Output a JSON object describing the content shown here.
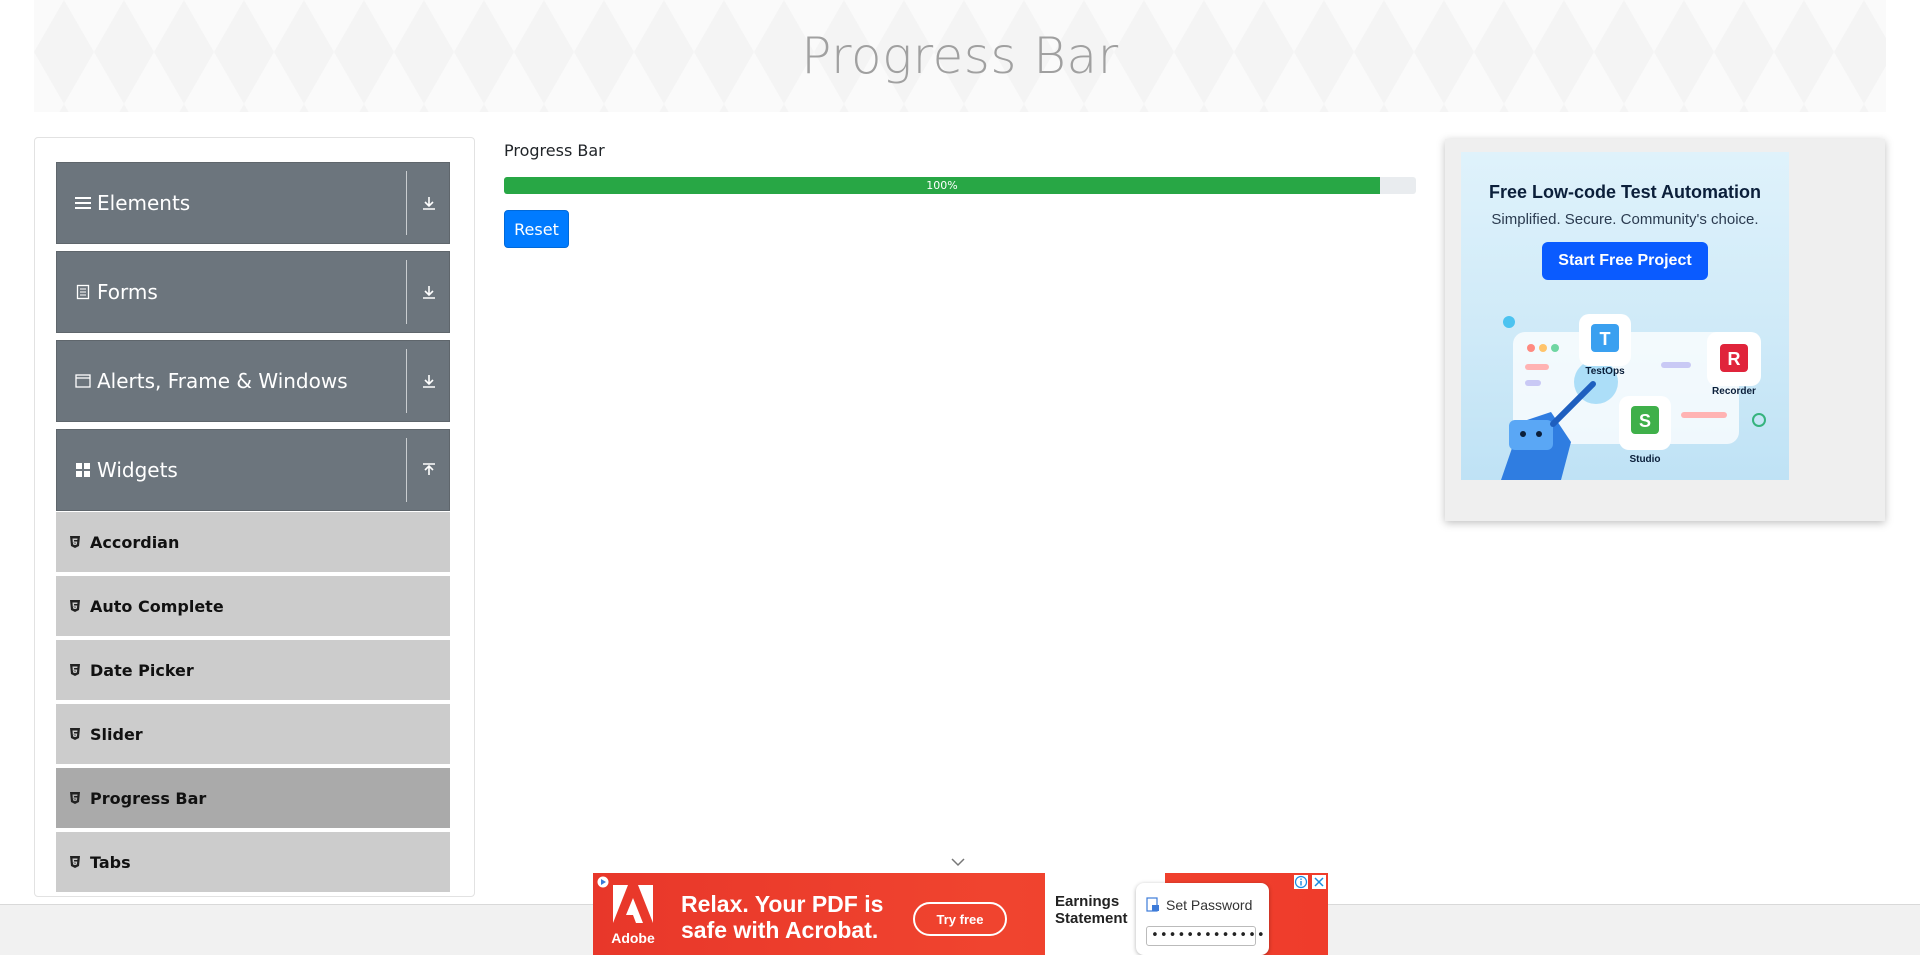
{
  "header": {
    "title": "Progress Bar"
  },
  "sidebar": {
    "groups": [
      {
        "label": "Elements",
        "icon": "hamburger-icon",
        "expanded": false
      },
      {
        "label": "Forms",
        "icon": "document-icon",
        "expanded": false
      },
      {
        "label": "Alerts, Frame & Windows",
        "icon": "window-icon",
        "expanded": false
      },
      {
        "label": "Widgets",
        "icon": "grid-icon",
        "expanded": true
      }
    ],
    "widget_items": [
      {
        "label": "Accordian"
      },
      {
        "label": "Auto Complete"
      },
      {
        "label": "Date Picker"
      },
      {
        "label": "Slider"
      },
      {
        "label": "Progress Bar",
        "active": true
      },
      {
        "label": "Tabs"
      }
    ]
  },
  "main": {
    "section_label": "Progress Bar",
    "progress": {
      "value_percent": 100,
      "label": "100%",
      "color": "#28a745"
    },
    "reset_label": "Reset"
  },
  "ad_right": {
    "title": "Free Low-code Test Automation",
    "subtitle": "Simplified. Secure. Community's choice.",
    "cta": "Start Free Project",
    "products": [
      "TestOps",
      "Recorder",
      "Studio"
    ]
  },
  "ad_bottom": {
    "brand": "Adobe",
    "headline": "Relax. Your PDF is safe with Acrobat.",
    "cta": "Try free",
    "doc_title": "Earnings Statement",
    "password_label": "Set Password",
    "password_value": "•••••••••••••"
  },
  "colors": {
    "accent": "#007bff",
    "sidebar_header": "#6c757d",
    "sidebar_item": "#cccccc",
    "sidebar_item_active": "#aaaaaa"
  }
}
